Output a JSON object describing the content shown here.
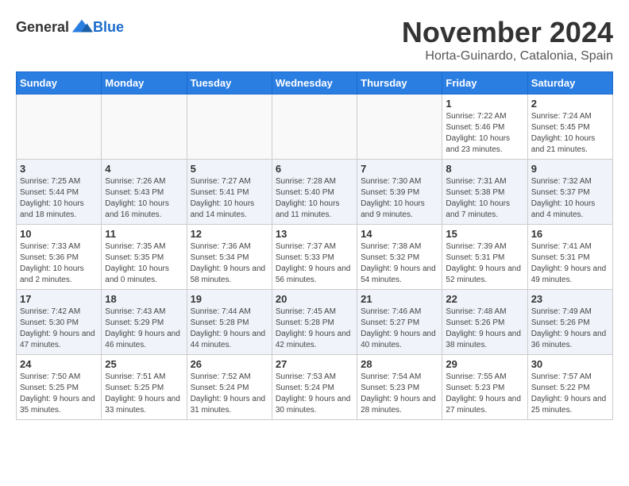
{
  "header": {
    "logo_general": "General",
    "logo_blue": "Blue",
    "month_title": "November 2024",
    "location": "Horta-Guinardo, Catalonia, Spain"
  },
  "weekdays": [
    "Sunday",
    "Monday",
    "Tuesday",
    "Wednesday",
    "Thursday",
    "Friday",
    "Saturday"
  ],
  "weeks": [
    [
      {
        "day": "",
        "info": ""
      },
      {
        "day": "",
        "info": ""
      },
      {
        "day": "",
        "info": ""
      },
      {
        "day": "",
        "info": ""
      },
      {
        "day": "",
        "info": ""
      },
      {
        "day": "1",
        "info": "Sunrise: 7:22 AM\nSunset: 5:46 PM\nDaylight: 10 hours and 23 minutes."
      },
      {
        "day": "2",
        "info": "Sunrise: 7:24 AM\nSunset: 5:45 PM\nDaylight: 10 hours and 21 minutes."
      }
    ],
    [
      {
        "day": "3",
        "info": "Sunrise: 7:25 AM\nSunset: 5:44 PM\nDaylight: 10 hours and 18 minutes."
      },
      {
        "day": "4",
        "info": "Sunrise: 7:26 AM\nSunset: 5:43 PM\nDaylight: 10 hours and 16 minutes."
      },
      {
        "day": "5",
        "info": "Sunrise: 7:27 AM\nSunset: 5:41 PM\nDaylight: 10 hours and 14 minutes."
      },
      {
        "day": "6",
        "info": "Sunrise: 7:28 AM\nSunset: 5:40 PM\nDaylight: 10 hours and 11 minutes."
      },
      {
        "day": "7",
        "info": "Sunrise: 7:30 AM\nSunset: 5:39 PM\nDaylight: 10 hours and 9 minutes."
      },
      {
        "day": "8",
        "info": "Sunrise: 7:31 AM\nSunset: 5:38 PM\nDaylight: 10 hours and 7 minutes."
      },
      {
        "day": "9",
        "info": "Sunrise: 7:32 AM\nSunset: 5:37 PM\nDaylight: 10 hours and 4 minutes."
      }
    ],
    [
      {
        "day": "10",
        "info": "Sunrise: 7:33 AM\nSunset: 5:36 PM\nDaylight: 10 hours and 2 minutes."
      },
      {
        "day": "11",
        "info": "Sunrise: 7:35 AM\nSunset: 5:35 PM\nDaylight: 10 hours and 0 minutes."
      },
      {
        "day": "12",
        "info": "Sunrise: 7:36 AM\nSunset: 5:34 PM\nDaylight: 9 hours and 58 minutes."
      },
      {
        "day": "13",
        "info": "Sunrise: 7:37 AM\nSunset: 5:33 PM\nDaylight: 9 hours and 56 minutes."
      },
      {
        "day": "14",
        "info": "Sunrise: 7:38 AM\nSunset: 5:32 PM\nDaylight: 9 hours and 54 minutes."
      },
      {
        "day": "15",
        "info": "Sunrise: 7:39 AM\nSunset: 5:31 PM\nDaylight: 9 hours and 52 minutes."
      },
      {
        "day": "16",
        "info": "Sunrise: 7:41 AM\nSunset: 5:31 PM\nDaylight: 9 hours and 49 minutes."
      }
    ],
    [
      {
        "day": "17",
        "info": "Sunrise: 7:42 AM\nSunset: 5:30 PM\nDaylight: 9 hours and 47 minutes."
      },
      {
        "day": "18",
        "info": "Sunrise: 7:43 AM\nSunset: 5:29 PM\nDaylight: 9 hours and 46 minutes."
      },
      {
        "day": "19",
        "info": "Sunrise: 7:44 AM\nSunset: 5:28 PM\nDaylight: 9 hours and 44 minutes."
      },
      {
        "day": "20",
        "info": "Sunrise: 7:45 AM\nSunset: 5:28 PM\nDaylight: 9 hours and 42 minutes."
      },
      {
        "day": "21",
        "info": "Sunrise: 7:46 AM\nSunset: 5:27 PM\nDaylight: 9 hours and 40 minutes."
      },
      {
        "day": "22",
        "info": "Sunrise: 7:48 AM\nSunset: 5:26 PM\nDaylight: 9 hours and 38 minutes."
      },
      {
        "day": "23",
        "info": "Sunrise: 7:49 AM\nSunset: 5:26 PM\nDaylight: 9 hours and 36 minutes."
      }
    ],
    [
      {
        "day": "24",
        "info": "Sunrise: 7:50 AM\nSunset: 5:25 PM\nDaylight: 9 hours and 35 minutes."
      },
      {
        "day": "25",
        "info": "Sunrise: 7:51 AM\nSunset: 5:25 PM\nDaylight: 9 hours and 33 minutes."
      },
      {
        "day": "26",
        "info": "Sunrise: 7:52 AM\nSunset: 5:24 PM\nDaylight: 9 hours and 31 minutes."
      },
      {
        "day": "27",
        "info": "Sunrise: 7:53 AM\nSunset: 5:24 PM\nDaylight: 9 hours and 30 minutes."
      },
      {
        "day": "28",
        "info": "Sunrise: 7:54 AM\nSunset: 5:23 PM\nDaylight: 9 hours and 28 minutes."
      },
      {
        "day": "29",
        "info": "Sunrise: 7:55 AM\nSunset: 5:23 PM\nDaylight: 9 hours and 27 minutes."
      },
      {
        "day": "30",
        "info": "Sunrise: 7:57 AM\nSunset: 5:22 PM\nDaylight: 9 hours and 25 minutes."
      }
    ]
  ]
}
